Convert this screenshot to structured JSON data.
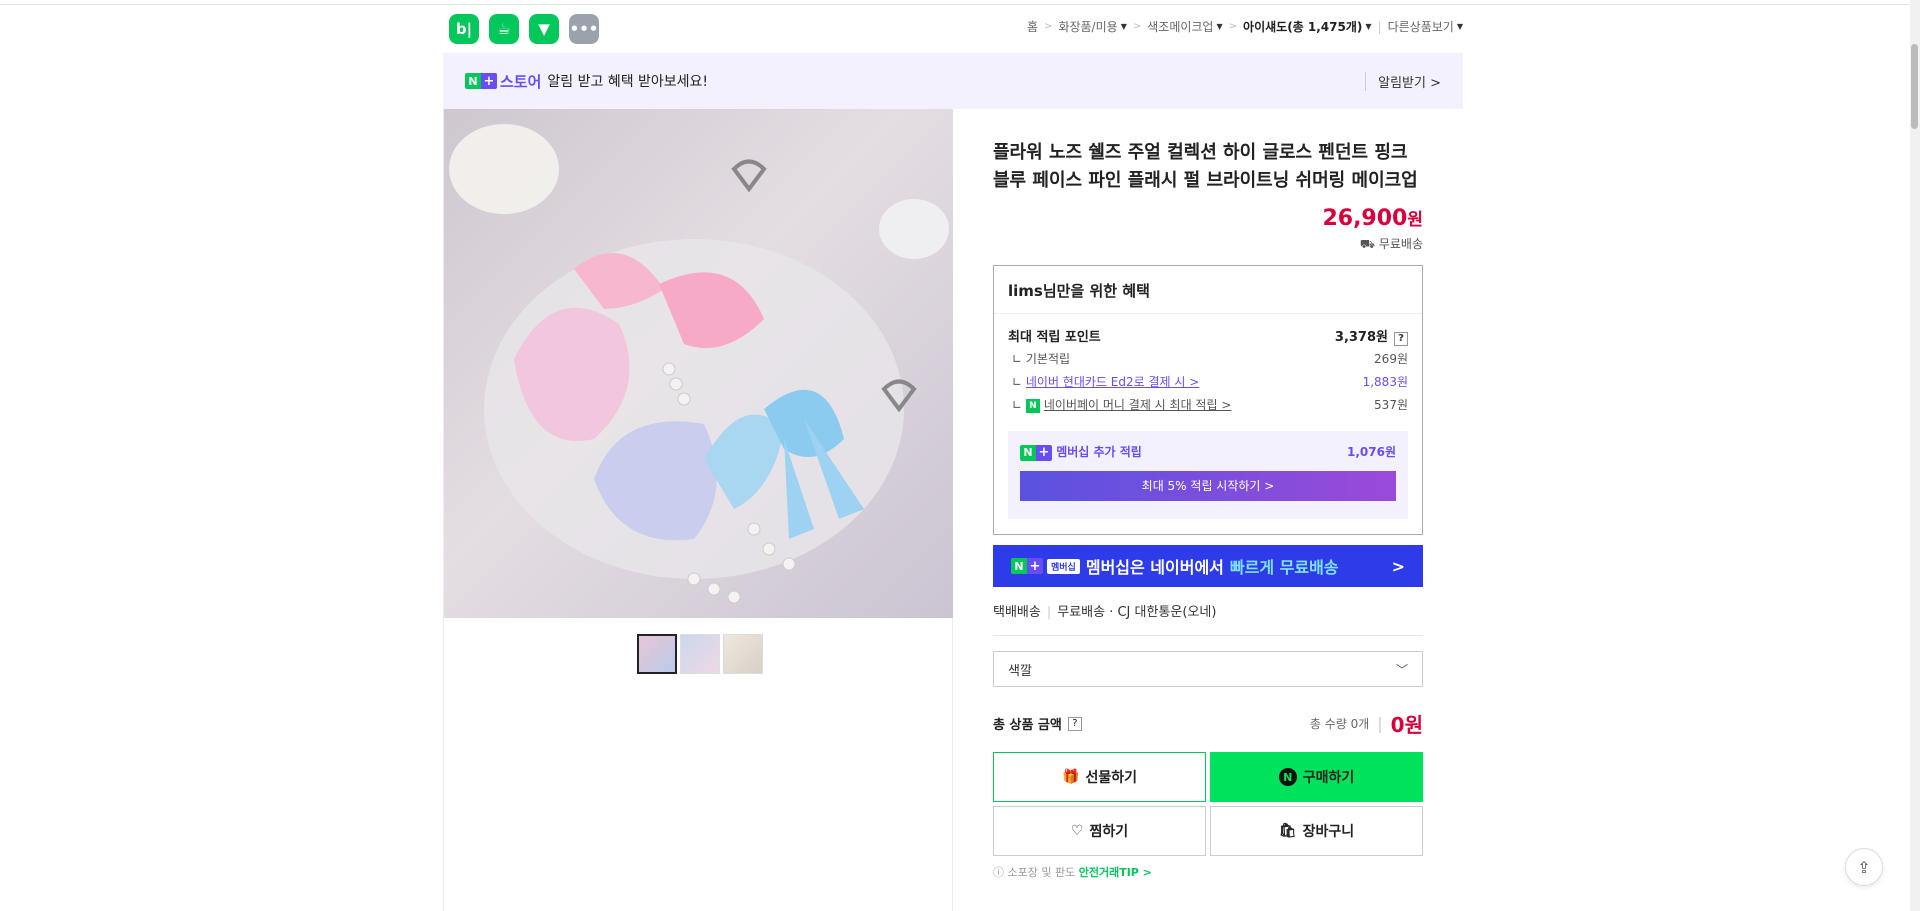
{
  "header": {
    "apps": [
      {
        "icon": "blog-app-icon",
        "glyph": "b|"
      },
      {
        "icon": "cafe-app-icon",
        "glyph": "☕"
      },
      {
        "icon": "bookmark-app-icon",
        "glyph": "▼"
      },
      {
        "icon": "more-app-icon",
        "glyph": "•••"
      }
    ],
    "breadcrumb": {
      "home": "홈",
      "cat1": "화장품/미용",
      "cat2": "색조메이크업",
      "cat3": "아이섀도(총 1,475개)",
      "other": "다른상품보기"
    }
  },
  "banner": {
    "n": "N",
    "plus": "+",
    "store": "스토어",
    "message": "알림 받고 혜택 받아보세요!",
    "alarm": "알림받기 >"
  },
  "product": {
    "title": "플라워 노즈 쉘즈 주얼 컬렉션 하이 글로스 펜던트 핑크 블루 페이스 파인 플래시 펄 브라이트닝 쉬머링 메이크업",
    "price": "26,900",
    "currency": "원",
    "shipping": "무료배송"
  },
  "benefit": {
    "title": "lims님만을 위한 혜택",
    "max_point_label": "최대 적립 포인트",
    "max_point_value": "3,378원",
    "basic_label": "기본적립",
    "basic_value": "269원",
    "card_label": "네이버 현대카드 Ed2로 결제 시 >",
    "card_value": "1,883원",
    "pay_label": "네이버페이 머니 결제 시 최대 적립 >",
    "pay_value": "537원",
    "membership_label": "멤버십 추가 적립",
    "membership_value": "1,076원",
    "membership_button": "최대 5% 적립 시작하기 >"
  },
  "membership_banner": {
    "tag": "멤버십",
    "text": "멤버십은 네이버에서",
    "highlight": "빠르게 무료배송",
    "chevron": ">"
  },
  "delivery": {
    "type": "택배배송",
    "fee": "무료배송",
    "carrier": "· CJ 대한통운(오네)"
  },
  "option": {
    "label": "색깔"
  },
  "total": {
    "label": "총 상품 금액",
    "qty": "총 수량 0개",
    "amount": "0원"
  },
  "buttons": {
    "gift": "선물하기",
    "buy": "구매하기",
    "wish": "찜하기",
    "cart": "장바구니"
  },
  "safe": {
    "prefix": "ⓘ 소포장 및 판도",
    "link": "안전거래TIP >"
  },
  "colors": {
    "accent_green": "#03c75a",
    "price_red": "#d7003a",
    "purple": "#6a4cf5",
    "member_blue": "#2d3be8"
  }
}
